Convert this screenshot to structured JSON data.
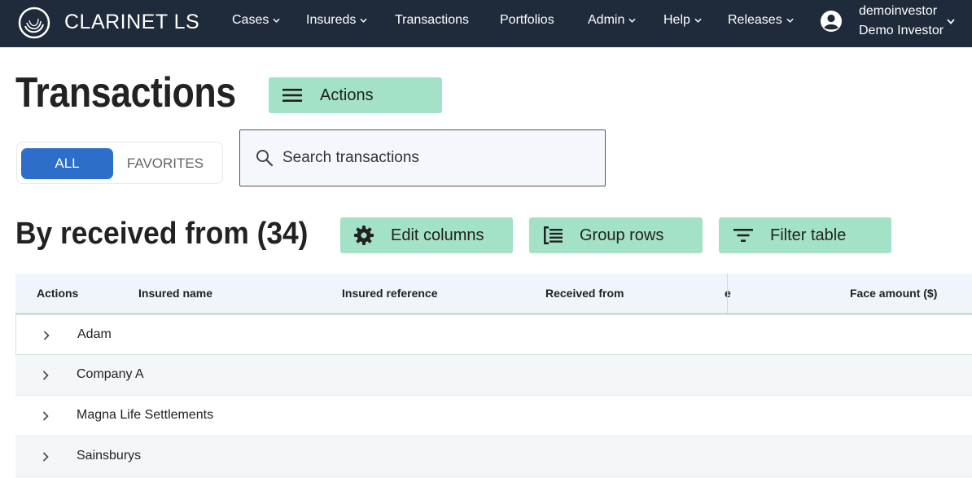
{
  "app": {
    "brand": "CLARINET LS"
  },
  "nav": {
    "items": [
      {
        "label": "Cases",
        "dropdown": true
      },
      {
        "label": "Insureds",
        "dropdown": true
      },
      {
        "label": "Transactions",
        "dropdown": false
      },
      {
        "label": "Portfolios",
        "dropdown": false
      },
      {
        "label": "Admin",
        "dropdown": true
      },
      {
        "label": "Help",
        "dropdown": true
      },
      {
        "label": "Releases",
        "dropdown": true
      }
    ],
    "user": {
      "username": "demoinvestor",
      "display_name": "Demo Investor"
    }
  },
  "page": {
    "title": "Transactions",
    "actions_label": "Actions",
    "toggle": {
      "all": "ALL",
      "favorites": "FAVORITES",
      "selected": "ALL"
    },
    "search": {
      "placeholder": "Search transactions",
      "value": ""
    }
  },
  "section": {
    "title": "By received from (34)",
    "edit_columns_label": "Edit columns",
    "group_rows_label": "Group rows",
    "filter_table_label": "Filter table"
  },
  "table": {
    "columns": [
      "Actions",
      "Insured name",
      "Insured reference",
      "Received from",
      "e",
      "Face amount ($)"
    ],
    "groups": [
      "Adam",
      "Company A",
      "Magna Life Settlements",
      "Sainsburys"
    ]
  },
  "colors": {
    "topbar": "#1f2b3a",
    "accent_green": "#a3e2c6",
    "toggle_blue": "#2d6ecb"
  },
  "icons": {
    "logo": "clarinet-logo",
    "user": "account-circle-icon",
    "menu": "menu-icon",
    "gear": "gear-icon",
    "group": "group-rows-icon",
    "filter": "filter-icon",
    "search": "search-icon",
    "expand": "chevron-right-icon"
  }
}
